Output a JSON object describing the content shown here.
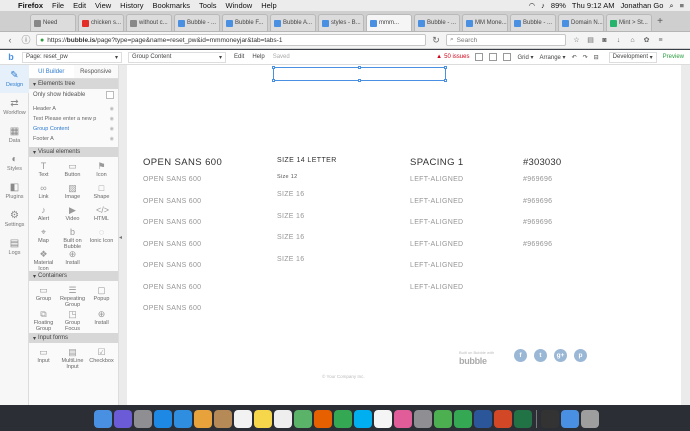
{
  "menubar": {
    "app": "Firefox",
    "items": [
      "File",
      "Edit",
      "View",
      "History",
      "Bookmarks",
      "Tools",
      "Window",
      "Help"
    ],
    "battery": "89%",
    "clock": "Thu 9:12 AM",
    "user": "Jonathan Go"
  },
  "tabs": [
    {
      "label": "Need",
      "icon": "document-icon",
      "fav": "gray"
    },
    {
      "label": "chicken s...",
      "icon": "youtube-icon",
      "fav": "yt"
    },
    {
      "label": "without c...",
      "icon": "document-icon",
      "fav": "gray"
    },
    {
      "label": "Bubble - ...",
      "icon": "bubble-icon",
      "fav": "b"
    },
    {
      "label": "Bubble F...",
      "icon": "bubble-icon",
      "fav": "b"
    },
    {
      "label": "Bubble A...",
      "icon": "bubble-icon",
      "fav": "b"
    },
    {
      "label": "styles - B...",
      "icon": "bubble-icon",
      "fav": "b"
    },
    {
      "label": "mmm...",
      "icon": "bubble-icon",
      "fav": "b",
      "active": true
    },
    {
      "label": "Bubble - ...",
      "icon": "bubble-icon",
      "fav": "b"
    },
    {
      "label": "MM Mone...",
      "icon": "bubble-icon",
      "fav": "b"
    },
    {
      "label": "Bubble - ...",
      "icon": "bubble-icon",
      "fav": "b"
    },
    {
      "label": "Domain N...",
      "icon": "bubble-icon",
      "fav": "b"
    },
    {
      "label": "Mint > St...",
      "icon": "mint-icon",
      "fav": "mint"
    }
  ],
  "nav": {
    "url_prefix": "https://",
    "url_host": "bubble.is",
    "url_rest": "/page?type=page&name=reset_pw&id=mmmoneyjar&tab=tabs-1",
    "search_placeholder": "Search"
  },
  "toolbar": {
    "page_label": "Page: reset_pw",
    "group_label": "Group Content",
    "edit": "Edit",
    "help": "Help",
    "saved": "Saved",
    "issues": "50 issues",
    "grid": "Grid",
    "arrange": "Arrange",
    "development": "Development",
    "preview": "Preview"
  },
  "rail": [
    {
      "label": "Design",
      "active": true
    },
    {
      "label": "Workflow"
    },
    {
      "label": "Data"
    },
    {
      "label": "Styles"
    },
    {
      "label": "Plugins"
    },
    {
      "label": "Settings"
    },
    {
      "label": "Logs"
    }
  ],
  "panel": {
    "tab_ui": "UI Builder",
    "tab_responsive": "Responsive",
    "elements_tree": "Elements tree",
    "only_hideable": "Only show hideable",
    "tree": [
      {
        "label": "Header A"
      },
      {
        "label": "Text Please enter a new p"
      },
      {
        "label": "Group Content",
        "sel": true
      },
      {
        "label": "Footer A"
      }
    ],
    "visual_elements": "Visual elements",
    "visual": [
      {
        "label": "Text",
        "icon": "text-icon"
      },
      {
        "label": "Button",
        "icon": "button-icon"
      },
      {
        "label": "Icon",
        "icon": "flag-icon"
      },
      {
        "label": "Link",
        "icon": "link-icon"
      },
      {
        "label": "Image",
        "icon": "image-icon"
      },
      {
        "label": "Shape",
        "icon": "shape-icon"
      },
      {
        "label": "Alert",
        "icon": "bell-icon"
      },
      {
        "label": "Video",
        "icon": "video-icon"
      },
      {
        "label": "HTML",
        "icon": "code-icon"
      },
      {
        "label": "Map",
        "icon": "map-pin-icon"
      },
      {
        "label": "Built on Bubble",
        "icon": "bubble-icon"
      },
      {
        "label": "Ionic Icon",
        "icon": "ionic-icon"
      },
      {
        "label": "Material Icon",
        "icon": "material-icon"
      },
      {
        "label": "Install",
        "icon": "plus-icon"
      }
    ],
    "containers": "Containers",
    "container_items": [
      {
        "label": "Group",
        "icon": "group-icon"
      },
      {
        "label": "Repeating Group",
        "icon": "repeating-group-icon"
      },
      {
        "label": "Popup",
        "icon": "popup-icon"
      },
      {
        "label": "Floating Group",
        "icon": "floating-group-icon"
      },
      {
        "label": "Group Focus",
        "icon": "group-focus-icon"
      },
      {
        "label": "Install",
        "icon": "plus-icon"
      }
    ],
    "input_forms": "Input forms",
    "input_items": [
      {
        "label": "Input",
        "icon": "input-icon"
      },
      {
        "label": "MultiLine Input",
        "icon": "multiline-input-icon"
      },
      {
        "label": "Checkbox",
        "icon": "checkbox-icon"
      }
    ]
  },
  "canvas": {
    "columns": [
      {
        "header": "OPEN SANS 600",
        "rows": [
          "OPEN SANS 600",
          "OPEN SANS 600",
          "OPEN SANS 600",
          "OPEN SANS 600",
          "OPEN SANS 600",
          "OPEN SANS 600",
          "OPEN SANS 600"
        ]
      },
      {
        "header": "SIZE 14 LETTER",
        "rows": [
          "Size 12",
          "SIZE 16",
          "SIZE 16",
          "SIZE 16",
          "SIZE 16"
        ]
      },
      {
        "header": "SPACING 1",
        "rows": [
          "LEFT-ALIGNED",
          "LEFT-ALIGNED",
          "LEFT-ALIGNED",
          "LEFT-ALIGNED",
          "LEFT-ALIGNED",
          "LEFT-ALIGNED"
        ]
      },
      {
        "header": "#303030",
        "rows": [
          "#969696",
          "#969696",
          "#969696",
          "#969696"
        ]
      }
    ],
    "built_with": "Built on Bubble with",
    "bubble_logo": "bubble",
    "social": [
      "f",
      "t",
      "g+",
      "p"
    ],
    "copyright": "© Your Company Inc."
  },
  "colors": {
    "accent": "#2e7bcf",
    "heading": "#303030",
    "muted": "#969696",
    "issues": "#d0021b",
    "preview": "#2a9d3f"
  },
  "dock": [
    {
      "icon": "finder-icon",
      "color": "#4a90e2"
    },
    {
      "icon": "siri-icon",
      "color": "#6b5bd6"
    },
    {
      "icon": "launchpad-icon",
      "color": "#8e8e93"
    },
    {
      "icon": "app-store-icon",
      "color": "#1e88e5"
    },
    {
      "icon": "safari-icon",
      "color": "#2f8ee0"
    },
    {
      "icon": "photos-icon",
      "color": "#e8a23c"
    },
    {
      "icon": "contacts-icon",
      "color": "#b58a56"
    },
    {
      "icon": "calendar-icon",
      "color": "#f2f2f2"
    },
    {
      "icon": "notes-icon",
      "color": "#f6d64a"
    },
    {
      "icon": "reminders-icon",
      "color": "#eeeeee"
    },
    {
      "icon": "maps-icon",
      "color": "#5bb36a"
    },
    {
      "icon": "firefox-icon",
      "color": "#e66000"
    },
    {
      "icon": "chrome-icon",
      "color": "#34a853"
    },
    {
      "icon": "skype-icon",
      "color": "#00aff0"
    },
    {
      "icon": "itunes-icon",
      "color": "#f5f5f5"
    },
    {
      "icon": "music-icon",
      "color": "#e05d9a"
    },
    {
      "icon": "system-prefs-icon",
      "color": "#8e8e93"
    },
    {
      "icon": "utorrent-icon",
      "color": "#4caf50"
    },
    {
      "icon": "numbers-icon",
      "color": "#35a853"
    },
    {
      "icon": "word-icon",
      "color": "#2b579a"
    },
    {
      "icon": "powerpoint-icon",
      "color": "#d24726"
    },
    {
      "icon": "excel-icon",
      "color": "#217346"
    },
    {
      "icon": "terminal-icon",
      "color": "#333333"
    },
    {
      "icon": "downloads-icon",
      "color": "#4a90e2"
    },
    {
      "icon": "trash-icon",
      "color": "#9e9e9e"
    }
  ]
}
